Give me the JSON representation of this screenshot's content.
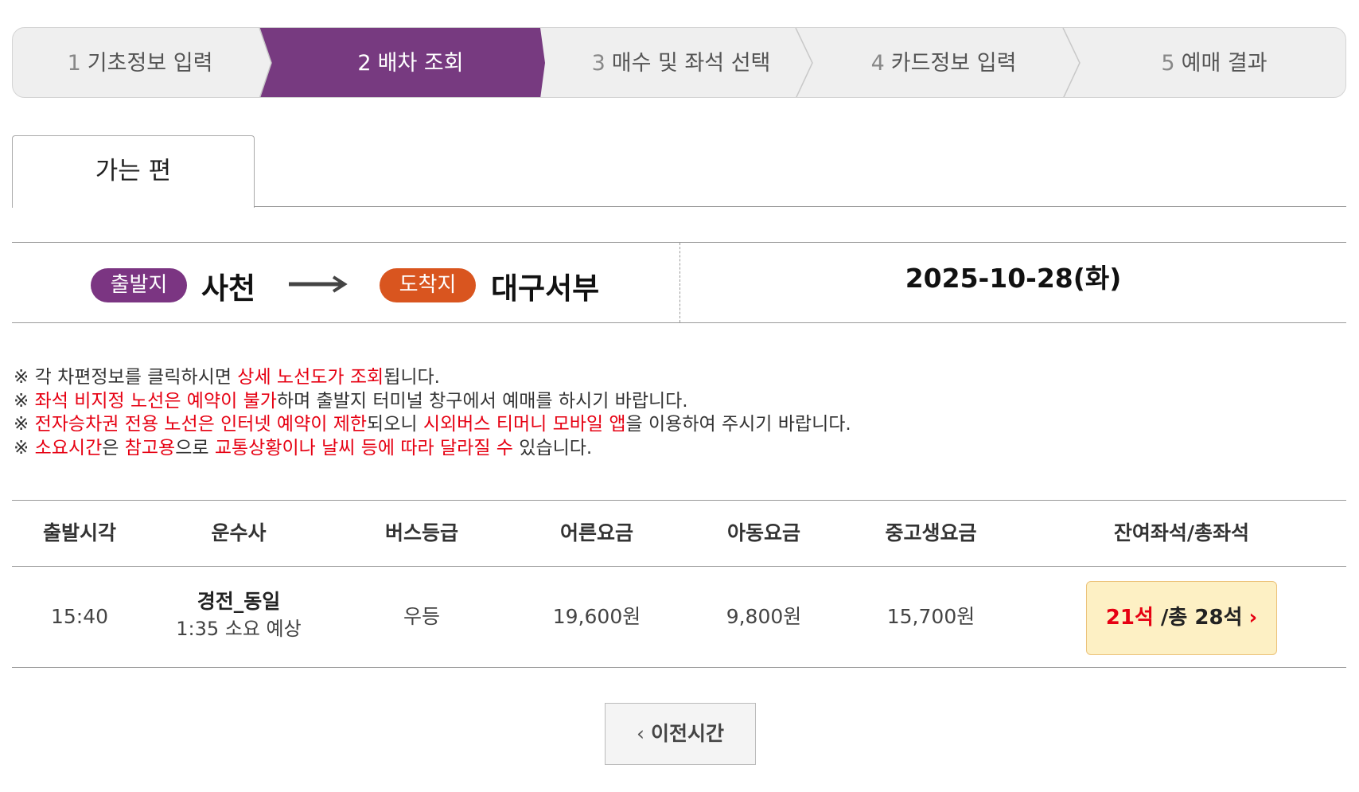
{
  "steps": [
    {
      "num": "1",
      "label": "기초정보 입력"
    },
    {
      "num": "2",
      "label": "배차 조회"
    },
    {
      "num": "3",
      "label": "매수 및 좌석 선택"
    },
    {
      "num": "4",
      "label": "카드정보 입력"
    },
    {
      "num": "5",
      "label": "예매 결과"
    }
  ],
  "active_step": 2,
  "colors": {
    "active_step": "#773a80",
    "departure_badge": "#7b3582",
    "arrival_badge": "#d9551f",
    "notice_highlight": "#e60012",
    "seat_button_bg": "#fdf0c4"
  },
  "tab": {
    "label": "가는 편"
  },
  "route": {
    "departure_badge": "출발지",
    "departure": "사천",
    "arrival_badge": "도착지",
    "arrival": "대구서부",
    "date": "2025-10-28(화)"
  },
  "notices": [
    {
      "mark": "※",
      "parts": [
        {
          "t": " 각 차편정보를 클릭하시면 ",
          "r": false
        },
        {
          "t": "상세 노선도가 조회",
          "r": true
        },
        {
          "t": "됩니다.",
          "r": false
        }
      ]
    },
    {
      "mark": "※",
      "parts": [
        {
          "t": " ",
          "r": false
        },
        {
          "t": "좌석 비지정 노선은 예약이 불가",
          "r": true
        },
        {
          "t": "하며 출발지 터미널 창구에서 예매를 하시기 바랍니다.",
          "r": false
        }
      ]
    },
    {
      "mark": "※",
      "parts": [
        {
          "t": " ",
          "r": false
        },
        {
          "t": "전자승차권 전용 노선은 인터넷 예약이 제한",
          "r": true
        },
        {
          "t": "되오니 ",
          "r": false
        },
        {
          "t": "시외버스 티머니 모바일 앱",
          "r": true
        },
        {
          "t": "을 이용하여 주시기 바랍니다.",
          "r": false
        }
      ]
    },
    {
      "mark": "※",
      "parts": [
        {
          "t": " ",
          "r": false
        },
        {
          "t": "소요시간",
          "r": true
        },
        {
          "t": "은 ",
          "r": false
        },
        {
          "t": "참고용",
          "r": true
        },
        {
          "t": "으로 ",
          "r": false
        },
        {
          "t": "교통상황이나 날씨 등에 따라 달라질 수",
          "r": true
        },
        {
          "t": " 있습니다.",
          "r": false
        }
      ]
    }
  ],
  "table": {
    "headers": {
      "departure_time": "출발시각",
      "company": "운수사",
      "bus_grade": "버스등급",
      "adult_fare": "어른요금",
      "child_fare": "아동요금",
      "student_fare": "중고생요금",
      "seats": "잔여좌석/총좌석"
    },
    "rows": [
      {
        "departure_time": "15:40",
        "company": "경전_동일",
        "duration": "1:35 소요 예상",
        "bus_grade": "우등",
        "adult_fare": "19,600원",
        "child_fare": "9,800원",
        "student_fare": "15,700원",
        "seats_remaining": "21석",
        "seats_total": " /총 28석",
        "seats_icon": "chevron-right-icon"
      }
    ]
  },
  "prev_button": {
    "label": "이전시간",
    "icon": "chevron-left-icon"
  }
}
